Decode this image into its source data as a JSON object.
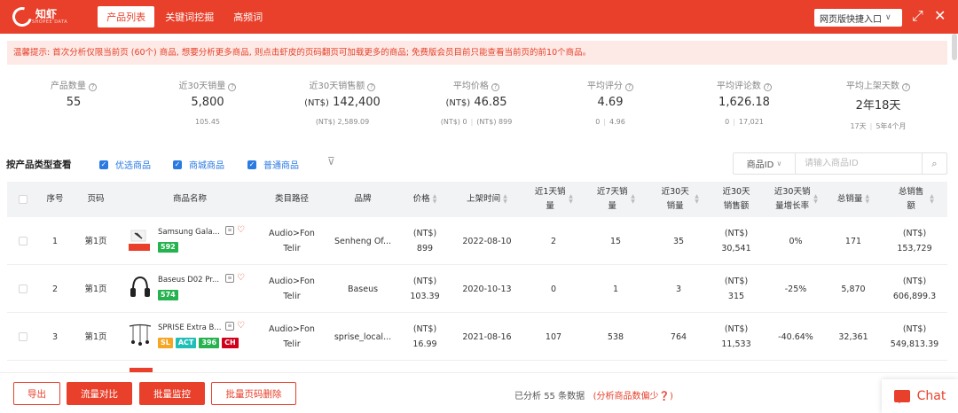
{
  "topbar": {
    "logo_text": "知虾",
    "logo_sub": "SHOPEE DATA",
    "tabs": [
      {
        "label": "产品列表",
        "active": true
      },
      {
        "label": "关键词挖掘",
        "active": false
      },
      {
        "label": "高频词",
        "active": false
      }
    ],
    "quick_entry": "网页版快捷入口",
    "expand_icon": "expand-icon",
    "close_icon": "close-icon"
  },
  "notice": "温馨提示: 首次分析仅限当前页 (60个) 商品, 想要分析更多商品, 则点击虾皮的页码翻页可加载更多的商品; 免费版会员目前只能查看当前页的前10个商品。",
  "stats": [
    {
      "label": "产品数量",
      "value": "55",
      "unit": "",
      "sub": [
        "",
        ""
      ]
    },
    {
      "label": "近30天销量",
      "value": "5,800",
      "unit": "",
      "sub": [
        "105.45",
        ""
      ]
    },
    {
      "label": "近30天销售额",
      "value": "142,400",
      "unit": "(NT$)",
      "sub": [
        "(NT$) 2,589.09",
        ""
      ]
    },
    {
      "label": "平均价格",
      "value": "46.85",
      "unit": "(NT$)",
      "sub": [
        "(NT$) 0",
        "(NT$) 899"
      ]
    },
    {
      "label": "平均评分",
      "value": "4.69",
      "unit": "",
      "sub": [
        "0",
        "4.96"
      ]
    },
    {
      "label": "平均评论数",
      "value": "1,626.18",
      "unit": "",
      "sub": [
        "0",
        "17,021"
      ]
    },
    {
      "label": "平均上架天数",
      "value": "2年18天",
      "unit": "",
      "sub": [
        "17天",
        "5年4个月"
      ]
    }
  ],
  "filter": {
    "title": "按产品类型查看",
    "options": [
      "优选商品",
      "商城商品",
      "普通商品"
    ],
    "search_select": "商品ID",
    "search_placeholder": "请输入商品ID"
  },
  "table": {
    "headers": {
      "index": "序号",
      "page": "页码",
      "name": "商品名称",
      "category": "类目路径",
      "brand": "品牌",
      "price": "价格",
      "listed": "上架时间",
      "sales1": "近1天销量",
      "sales7": "近7天销量",
      "sales30": "近30天销量",
      "revenue30": "近30天销售额",
      "growth30": "近30天销量增长率",
      "total_sales": "总销量",
      "total_revenue": "总销售额"
    },
    "rows": [
      {
        "index": "1",
        "page": "第1页",
        "name": "Samsung Gala...",
        "badges": [
          {
            "text": "592",
            "color": "#26b34f"
          }
        ],
        "category": "Audio>Fon Telir",
        "brand": "Senheng Of...",
        "price_unit": "(NT$)",
        "price": "899",
        "listed": "2022-08-10",
        "sales1": "2",
        "sales7": "15",
        "sales30": "35",
        "revenue_unit": "(NT$)",
        "revenue30": "30,541",
        "growth30": "0%",
        "total_sales": "171",
        "total_unit": "(NT$)",
        "total_revenue": "153,729"
      },
      {
        "index": "2",
        "page": "第1页",
        "name": "Baseus D02 Pr...",
        "badges": [
          {
            "text": "574",
            "color": "#26b34f"
          }
        ],
        "category": "Audio>Fon Telir",
        "brand": "Baseus",
        "price_unit": "(NT$)",
        "price": "103.39",
        "listed": "2020-10-13",
        "sales1": "0",
        "sales7": "1",
        "sales30": "3",
        "revenue_unit": "(NT$)",
        "revenue30": "315",
        "growth30": "-25%",
        "total_sales": "5,870",
        "total_unit": "(NT$)",
        "total_revenue": "606,899.3"
      },
      {
        "index": "3",
        "page": "第1页",
        "name": "SPRISE Extra B...",
        "badges": [
          {
            "text": "SL",
            "color": "#f5a623"
          },
          {
            "text": "ACT",
            "color": "#1fbfb8"
          },
          {
            "text": "396",
            "color": "#26b34f"
          },
          {
            "text": "CH",
            "color": "#d0021b"
          }
        ],
        "category": "Audio>Fon Telir",
        "brand": "sprise_local...",
        "price_unit": "(NT$)",
        "price": "16.99",
        "listed": "2021-08-16",
        "sales1": "107",
        "sales7": "538",
        "sales30": "764",
        "revenue_unit": "(NT$)",
        "revenue30": "11,533",
        "growth30": "-40.64%",
        "total_sales": "32,361",
        "total_unit": "(NT$)",
        "total_revenue": "549,813.39"
      }
    ]
  },
  "footer": {
    "export": "导出",
    "traffic_compare": "流量对比",
    "batch_monitor": "批量监控",
    "batch_delete": "批量页码删除",
    "status_prefix": "已分析",
    "status_count": "55",
    "status_suffix": "条数据",
    "status_link": "(分析商品数偏少",
    "chat": "Chat"
  },
  "colors": {
    "brand": "#e8402b",
    "accent_blue": "#2a7ae2",
    "notice_bg": "#fdeae6"
  }
}
